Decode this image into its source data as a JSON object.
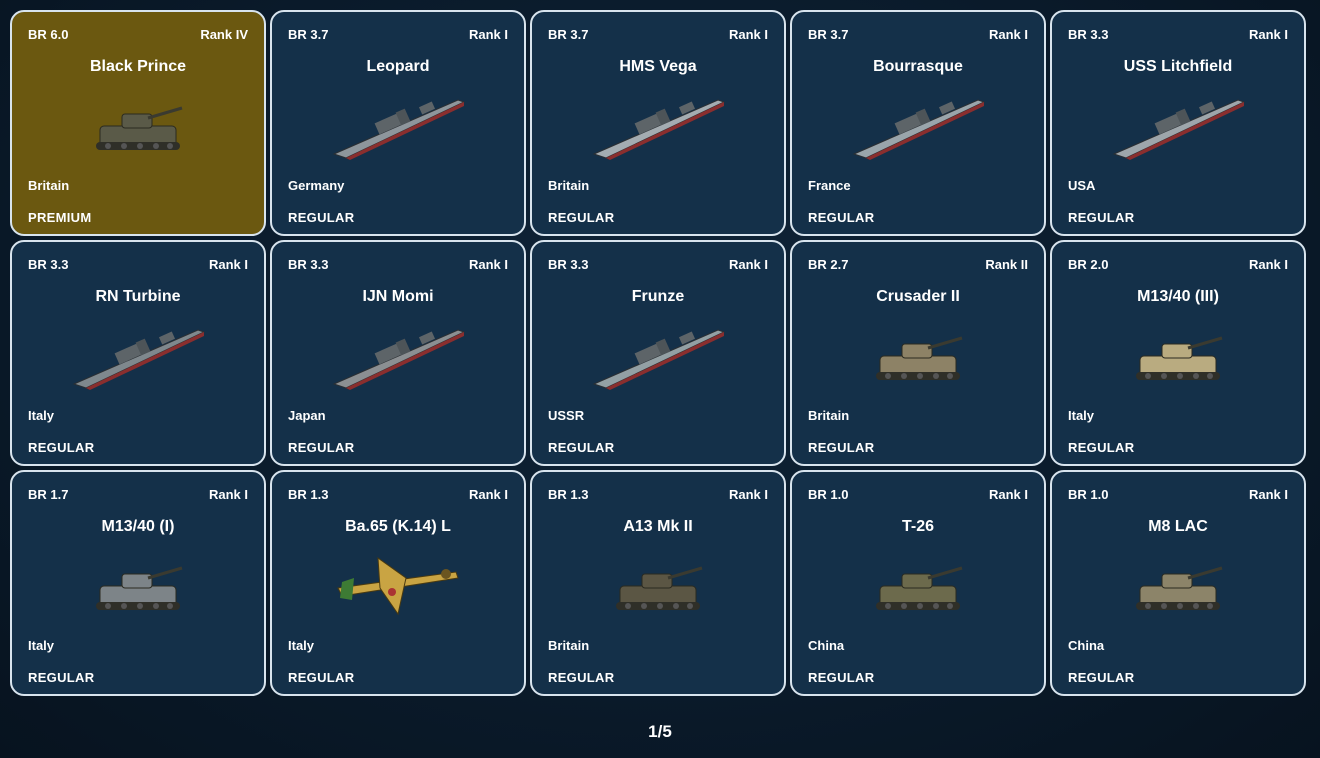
{
  "pager": {
    "label": "1/5"
  },
  "cards": [
    {
      "br": "BR 6.0",
      "rank": "Rank IV",
      "name": "Black Prince",
      "nation": "Britain",
      "type": "PREMIUM",
      "icon": "tank-icon",
      "tint": "#5a5a48"
    },
    {
      "br": "BR 3.7",
      "rank": "Rank I",
      "name": "Leopard",
      "nation": "Germany",
      "type": "REGULAR",
      "icon": "ship-icon",
      "tint": "#8e969c"
    },
    {
      "br": "BR 3.7",
      "rank": "Rank I",
      "name": "HMS Vega",
      "nation": "Britain",
      "type": "REGULAR",
      "icon": "ship-icon",
      "tint": "#a4acb1"
    },
    {
      "br": "BR 3.7",
      "rank": "Rank I",
      "name": "Bourrasque",
      "nation": "France",
      "type": "REGULAR",
      "icon": "ship-icon",
      "tint": "#9aa5ab"
    },
    {
      "br": "BR 3.3",
      "rank": "Rank I",
      "name": "USS Litchfield",
      "nation": "USA",
      "type": "REGULAR",
      "icon": "ship-icon",
      "tint": "#9ea6ab"
    },
    {
      "br": "BR 3.3",
      "rank": "Rank I",
      "name": "RN Turbine",
      "nation": "Italy",
      "type": "REGULAR",
      "icon": "ship-icon",
      "tint": "#7f888d"
    },
    {
      "br": "BR 3.3",
      "rank": "Rank I",
      "name": "IJN Momi",
      "nation": "Japan",
      "type": "REGULAR",
      "icon": "ship-icon",
      "tint": "#8b8f92"
    },
    {
      "br": "BR 3.3",
      "rank": "Rank I",
      "name": "Frunze",
      "nation": "USSR",
      "type": "REGULAR",
      "icon": "ship-icon",
      "tint": "#93a0a4"
    },
    {
      "br": "BR 2.7",
      "rank": "Rank II",
      "name": "Crusader II",
      "nation": "Britain",
      "type": "REGULAR",
      "icon": "tank-icon",
      "tint": "#8d8266"
    },
    {
      "br": "BR 2.0",
      "rank": "Rank I",
      "name": "M13/40 (III)",
      "nation": "Italy",
      "type": "REGULAR",
      "icon": "tank-icon",
      "tint": "#b9ab80"
    },
    {
      "br": "BR 1.7",
      "rank": "Rank I",
      "name": "M13/40 (I)",
      "nation": "Italy",
      "type": "REGULAR",
      "icon": "tank-icon",
      "tint": "#7d8488"
    },
    {
      "br": "BR 1.3",
      "rank": "Rank I",
      "name": "Ba.65 (K.14) L",
      "nation": "Italy",
      "type": "REGULAR",
      "icon": "plane-icon",
      "tint": "#c9a443"
    },
    {
      "br": "BR 1.3",
      "rank": "Rank I",
      "name": "A13 Mk II",
      "nation": "Britain",
      "type": "REGULAR",
      "icon": "tank-icon",
      "tint": "#5b5644"
    },
    {
      "br": "BR 1.0",
      "rank": "Rank I",
      "name": "T-26",
      "nation": "China",
      "type": "REGULAR",
      "icon": "tank-icon",
      "tint": "#6c6a4c"
    },
    {
      "br": "BR 1.0",
      "rank": "Rank I",
      "name": "M8 LAC",
      "nation": "China",
      "type": "REGULAR",
      "icon": "tank-icon",
      "tint": "#8c8469"
    }
  ]
}
